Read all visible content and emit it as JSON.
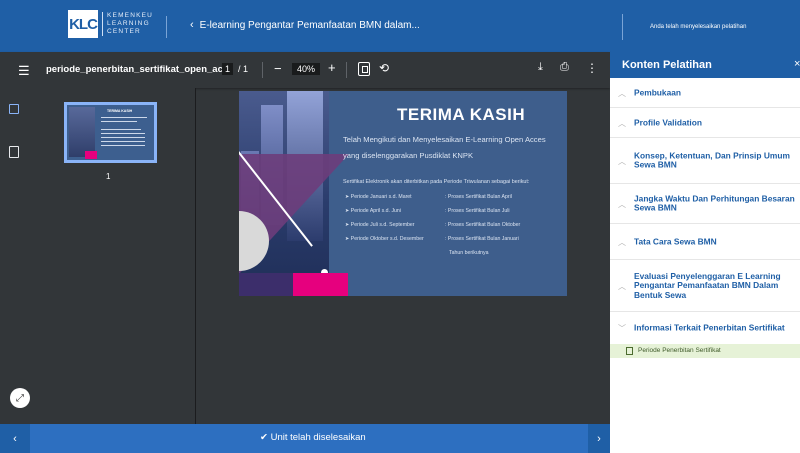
{
  "header": {
    "logo_mark": "KLC",
    "logo_lines": [
      "KEMENKEU",
      "LEARNING",
      "CENTER"
    ],
    "course_title": "E-learning Pengantar Pemanfaatan BMN dalam...",
    "completion_note": "Anda telah menyelesaikan pelatihan"
  },
  "pdf_viewer": {
    "file_name": "periode_penerbitan_sertifikat_open_ac...",
    "current_page": "1",
    "total_pages": "/ 1",
    "zoom": "40%",
    "thumbnail_page_number": "1",
    "icons": [
      "menu-icon",
      "fit-page-icon",
      "rotate-icon",
      "download-icon",
      "print-icon",
      "more-vertical-icon",
      "thumbnail-view-icon",
      "outline-view-icon",
      "expand-icon"
    ]
  },
  "slide": {
    "title": "TERIMA KASIH",
    "line1": "Telah Mengikuti dan Menyelesaikan E-Learning Open Acces",
    "line2": "yang diselenggarakan Pusdiklat KNPK",
    "info": "Sertifikat Elektronik akan diterbitkan pada Periode Triwulanan sebagai berikut:",
    "periods": [
      {
        "period": "➤  Periode Januari s.d. Maret",
        "status": ": Proses Sertifikat Bulan April"
      },
      {
        "period": "➤  Periode April s.d. Juni",
        "status": ": Proses Sertifikat Bulan Juli"
      },
      {
        "period": "➤  Periode  Juli s.d. September",
        "status": ": Proses Sertifikat Bulan Oktober"
      },
      {
        "period": "➤  Periode  Oktober s.d. Desember",
        "status": ": Proses Sertifikat Bulan Januari"
      }
    ],
    "status_continuation": "Tahun berikutnya"
  },
  "bottom_bar": {
    "prev": "‹",
    "next": "›",
    "done_label": "✔ Unit telah diselesaikan"
  },
  "sidebar": {
    "title": "Konten Pelatihan",
    "close": "×",
    "items": [
      "Pembukaan",
      "Profile Validation",
      "Konsep, Ketentuan, Dan Prinsip Umum Sewa BMN",
      "Jangka Waktu Dan Perhitungan Besaran Sewa BMN",
      "Tata Cara Sewa BMN",
      "Evaluasi Penyelenggaran E Learning Pengantar Pemanfaatan BMN Dalam Bentuk Sewa",
      "Informasi Terkait Penerbitan Sertifikat"
    ],
    "sub_item": "Periode Penerbitan Sertifikat"
  },
  "colors": {
    "brand_blue": "#1f5fa6",
    "viewer_dark": "#323639",
    "accent_pink": "#e6007e",
    "active_sub_bg": "#e6f2d7"
  }
}
